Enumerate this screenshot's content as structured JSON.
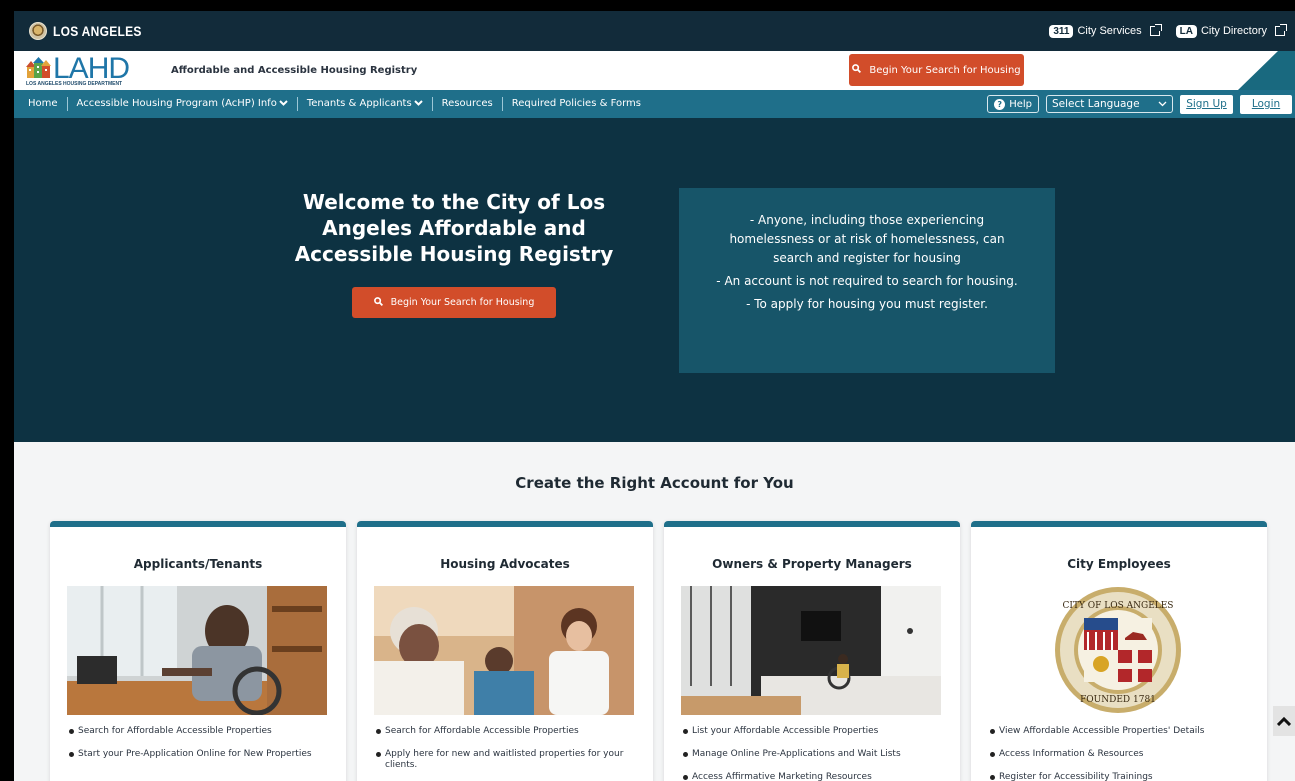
{
  "city_bar": {
    "city_name": "LOS ANGELES",
    "services_badge": "311",
    "services_label": "City Services",
    "directory_badge": "LA",
    "directory_label": "City Directory"
  },
  "header": {
    "logo_text": "LAHD",
    "logo_subtext": "LOS ANGELES HOUSING DEPARTMENT",
    "registry_title": "Affordable and Accessible Housing Registry",
    "search_button": "Begin Your Search for Housing"
  },
  "nav": {
    "items": [
      {
        "label": "Home",
        "dropdown": false
      },
      {
        "label": "Accessible Housing Program (AcHP) Info",
        "dropdown": true
      },
      {
        "label": "Tenants & Applicants",
        "dropdown": true
      },
      {
        "label": "Resources",
        "dropdown": false
      },
      {
        "label": "Required Policies & Forms",
        "dropdown": false
      }
    ],
    "help_label": "Help",
    "language_select": "Select Language",
    "signup_label": "Sign Up",
    "login_label": "Login"
  },
  "hero": {
    "title": "Welcome to the City of Los Angeles Affordable and Accessible Housing Registry",
    "search_button": "Begin Your Search for Housing",
    "info_lines": [
      "- Anyone, including those experiencing homelessness or at risk of homelessness, can search and register for housing",
      "- An account is not required to search for housing.",
      "- To apply for housing you must register."
    ]
  },
  "accounts": {
    "section_title": "Create the Right Account for You",
    "cards": [
      {
        "title": "Applicants/Tenants",
        "image": "person-in-wheelchair-at-desk-photo",
        "items": [
          "Search for Affordable Accessible Properties",
          "Start your Pre-Application Online for New Properties"
        ]
      },
      {
        "title": "Housing Advocates",
        "image": "advocate-with-client-photo",
        "items": [
          "Search for Affordable Accessible Properties",
          "Apply here for new and waitlisted properties for your clients."
        ]
      },
      {
        "title": "Owners & Property Managers",
        "image": "accessible-kitchen-photo",
        "items": [
          "List your Affordable Accessible Properties",
          "Manage Online Pre-Applications and Wait Lists",
          "Access Affirmative Marketing Resources"
        ]
      },
      {
        "title": "City Employees",
        "image": "city-seal",
        "items": [
          "View Affordable Accessible Properties' Details",
          "Access Information & Resources",
          "Register for Accessibility Trainings"
        ]
      }
    ]
  },
  "colors": {
    "city_bar": "#122b3a",
    "nav": "#1f6f8a",
    "hero": "#0d3242",
    "hero_box": "#175569",
    "accent_button": "#d24d2a",
    "card_top": "#1f6f8a"
  }
}
